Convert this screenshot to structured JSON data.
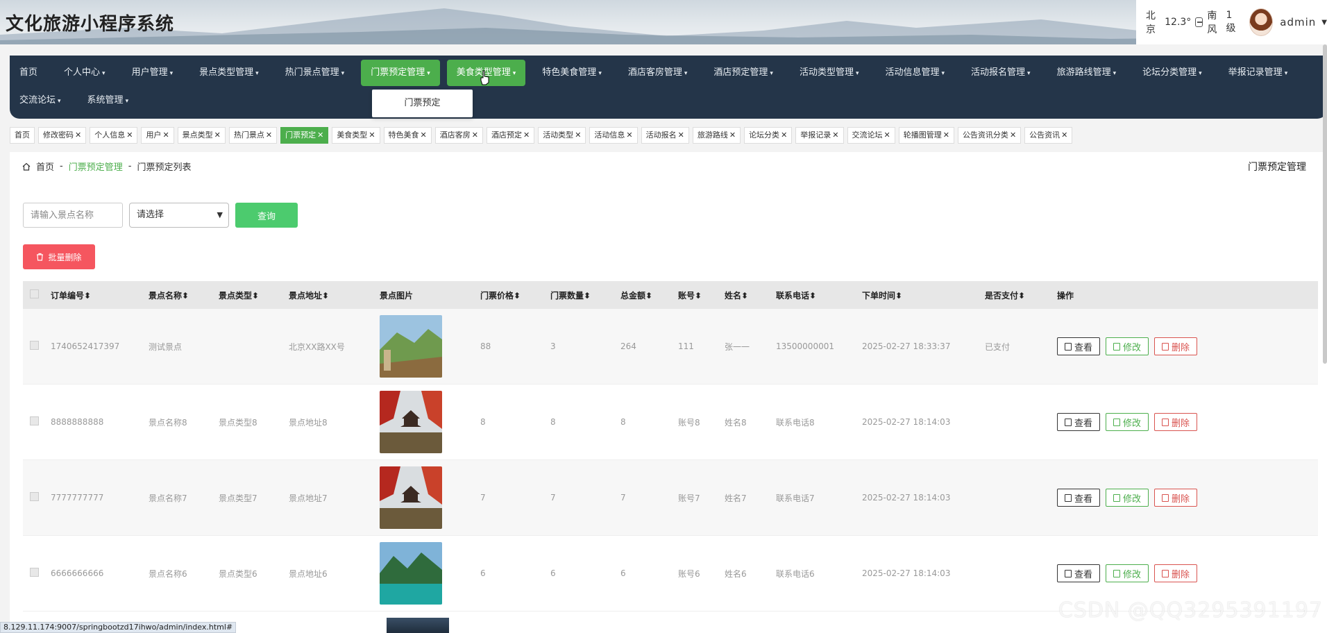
{
  "header": {
    "title": "文化旅游小程序系统",
    "weather": {
      "city": "北京",
      "temp": "12.3°",
      "icon": "cloud-icon",
      "wind": "南风",
      "level": "1级"
    },
    "user": {
      "name": "admin"
    }
  },
  "nav": {
    "row1": [
      {
        "label": "首页",
        "caret": ""
      },
      {
        "label": "个人中心",
        "caret": "▾"
      },
      {
        "label": "用户管理",
        "caret": "▾"
      },
      {
        "label": "景点类型管理",
        "caret": "▾"
      },
      {
        "label": "热门景点管理",
        "caret": "▾"
      },
      {
        "label": "门票预定管理",
        "caret": "▾"
      },
      {
        "label": "美食类型管理",
        "caret": "▾"
      },
      {
        "label": "特色美食管理",
        "caret": "▾"
      },
      {
        "label": "酒店客房管理",
        "caret": "▾"
      },
      {
        "label": "酒店预定管理",
        "caret": "▾"
      },
      {
        "label": "活动类型管理",
        "caret": "▾"
      },
      {
        "label": "活动信息管理",
        "caret": "▾"
      },
      {
        "label": "活动报名管理",
        "caret": "▾"
      },
      {
        "label": "旅游路线管理",
        "caret": "▾"
      },
      {
        "label": "论坛分类管理",
        "caret": "▾"
      },
      {
        "label": "举报记录管理",
        "caret": "▾"
      }
    ],
    "row2": [
      {
        "label": "交流论坛",
        "caret": "▾"
      },
      {
        "label": "系统管理",
        "caret": "▾"
      }
    ],
    "dropdown_item": "门票预定"
  },
  "tags": [
    {
      "label": "首页",
      "closable": false
    },
    {
      "label": "修改密码",
      "closable": true
    },
    {
      "label": "个人信息",
      "closable": true
    },
    {
      "label": "用户",
      "closable": true
    },
    {
      "label": "景点类型",
      "closable": true
    },
    {
      "label": "热门景点",
      "closable": true
    },
    {
      "label": "门票预定",
      "closable": true,
      "active": true
    },
    {
      "label": "美食类型",
      "closable": true
    },
    {
      "label": "特色美食",
      "closable": true
    },
    {
      "label": "酒店客房",
      "closable": true
    },
    {
      "label": "酒店预定",
      "closable": true
    },
    {
      "label": "活动类型",
      "closable": true
    },
    {
      "label": "活动信息",
      "closable": true
    },
    {
      "label": "活动报名",
      "closable": true
    },
    {
      "label": "旅游路线",
      "closable": true
    },
    {
      "label": "论坛分类",
      "closable": true
    },
    {
      "label": "举报记录",
      "closable": true
    },
    {
      "label": "交流论坛",
      "closable": true
    },
    {
      "label": "轮播图管理",
      "closable": true
    },
    {
      "label": "公告资讯分类",
      "closable": true
    },
    {
      "label": "公告资讯",
      "closable": true
    }
  ],
  "breadcrumb": {
    "home": "首页",
    "sep": "-",
    "section": "门票预定管理",
    "page": "门票预定列表"
  },
  "page_name": "门票预定管理",
  "search": {
    "placeholder": "请输入景点名称",
    "select_value": "请选择",
    "button": "查询"
  },
  "batch_delete": "批量删除",
  "table": {
    "columns": [
      "订单编号",
      "景点名称",
      "景点类型",
      "景点地址",
      "景点图片",
      "门票价格",
      "门票数量",
      "总金额",
      "账号",
      "姓名",
      "联系电话",
      "下单时间",
      "是否支付",
      "操作"
    ],
    "sort_mark": "⬍",
    "rows": [
      {
        "id": "1740652417397",
        "name": "测试景点",
        "type": "",
        "addr": "北京XX路XX号",
        "img": "mountain-temple",
        "price": "88",
        "qty": "3",
        "total": "264",
        "acct": "111",
        "uname": "张一一",
        "phone": "13500000001",
        "time": "2025-02-27 18:33:37",
        "paid": "已支付"
      },
      {
        "id": "8888888888",
        "name": "景点名称8",
        "type": "景点类型8",
        "addr": "景点地址8",
        "img": "pagoda-autumn",
        "price": "8",
        "qty": "8",
        "total": "8",
        "acct": "账号8",
        "uname": "姓名8",
        "phone": "联系电话8",
        "time": "2025-02-27 18:14:03",
        "paid": ""
      },
      {
        "id": "7777777777",
        "name": "景点名称7",
        "type": "景点类型7",
        "addr": "景点地址7",
        "img": "pagoda-autumn",
        "price": "7",
        "qty": "7",
        "total": "7",
        "acct": "账号7",
        "uname": "姓名7",
        "phone": "联系电话7",
        "time": "2025-02-27 18:14:03",
        "paid": ""
      },
      {
        "id": "6666666666",
        "name": "景点名称6",
        "type": "景点类型6",
        "addr": "景点地址6",
        "img": "lake-valley",
        "price": "6",
        "qty": "6",
        "total": "6",
        "acct": "账号6",
        "uname": "姓名6",
        "phone": "联系电话6",
        "time": "2025-02-27 18:14:03",
        "paid": ""
      }
    ],
    "ops": {
      "view": "查看",
      "edit": "修改",
      "delete": "删除"
    }
  },
  "status_url": "8.129.11.174:9007/springbootzd17ihwo/admin/index.html#",
  "watermark": "CSDN @QQ3295391197",
  "colors": {
    "nav_bg": "#243549",
    "accent_green": "#4cae4c",
    "search_btn": "#4ccb6e",
    "danger": "#f5565f"
  }
}
